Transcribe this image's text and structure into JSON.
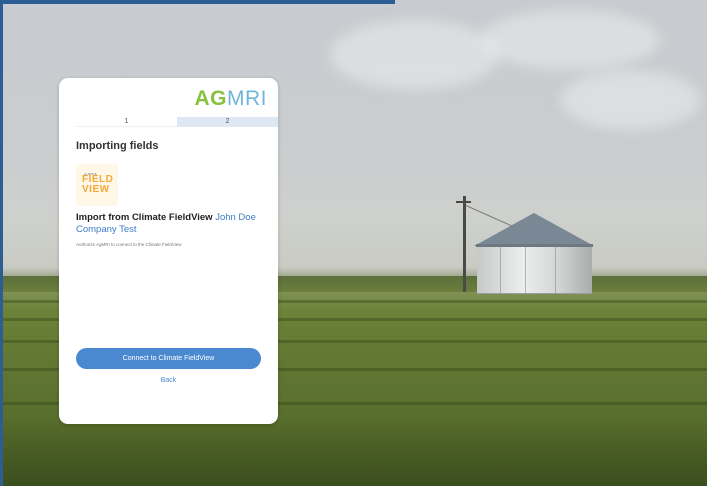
{
  "brand": {
    "logo_prefix": "AG",
    "logo_suffix": "MRI"
  },
  "stepper": {
    "steps": [
      {
        "label": "1"
      },
      {
        "label": "2"
      }
    ]
  },
  "card": {
    "title": "Importing fields",
    "provider_logo": {
      "small_text": "CLIMATE",
      "big_text_line1": "FIELD",
      "big_text_line2": "VIEW"
    },
    "import_text": "Import from Climate FieldView",
    "account_name": "John Doe Company Test",
    "authorize_text": "Authorize AgMRI to connect to the Climate FieldView",
    "connect_button": "Connect to Climate FieldView",
    "back_link": "Back"
  },
  "colors": {
    "accent": "#4a89d0",
    "logo_green": "#86c140",
    "logo_blue": "#6fb5dc",
    "step_inactive": "#dde8f3"
  }
}
